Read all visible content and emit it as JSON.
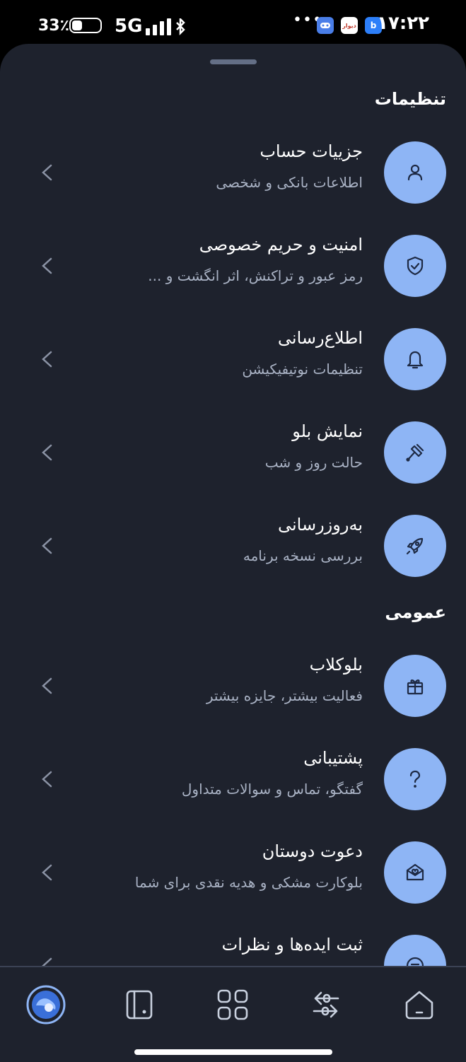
{
  "status_bar": {
    "time": "۱۷:۲۲",
    "battery_percent": "33٪",
    "network": "5G",
    "more": "•••",
    "app_icons": [
      "b-app-icon",
      "divar-app-icon",
      "game-app-icon"
    ],
    "divar_label": "دیوار"
  },
  "settings": {
    "section_title": "تنظیمات",
    "items": [
      {
        "title": "جزییات حساب",
        "subtitle": "اطلاعات بانکی و شخصی",
        "icon": "user-icon"
      },
      {
        "title": "امنیت و حریم خصوصی",
        "subtitle": "رمز عبور و تراکنش، اثر انگشت و ...",
        "icon": "shield-icon"
      },
      {
        "title": "اطلاع‌رسانی",
        "subtitle": "تنظیمات نوتیفیکیشن",
        "icon": "bell-icon"
      },
      {
        "title": "نمایش بلو",
        "subtitle": "حالت روز و شب",
        "icon": "brush-icon"
      },
      {
        "title": "به‌روزرسانی",
        "subtitle": "بررسی نسخه برنامه",
        "icon": "rocket-icon"
      }
    ]
  },
  "general": {
    "section_title": "عمومی",
    "items": [
      {
        "title": "بلوکلاب",
        "subtitle": "فعالیت بیشتر، جایزه بیشتر",
        "icon": "gift-icon"
      },
      {
        "title": "پشتیبانی",
        "subtitle": "گفتگو، تماس و سوالات متداول",
        "icon": "question-icon"
      },
      {
        "title": "دعوت دوستان",
        "subtitle": "بلوکارت مشکی و هدیه نقدی برای شما",
        "icon": "invite-envelope-icon"
      },
      {
        "title": "ثبت ایده‌ها و نظرات",
        "subtitle": "",
        "icon": "feedback-chat-icon"
      }
    ]
  },
  "bottom_nav": {
    "items": [
      "profile-avatar-icon",
      "card-icon",
      "apps-grid-icon",
      "transfer-icon",
      "home-icon"
    ]
  },
  "colors": {
    "background": "#1e222d",
    "accent_circle": "#8eb5f5",
    "icon_stroke": "#1e2a44",
    "subtitle": "#a9b2c4"
  }
}
